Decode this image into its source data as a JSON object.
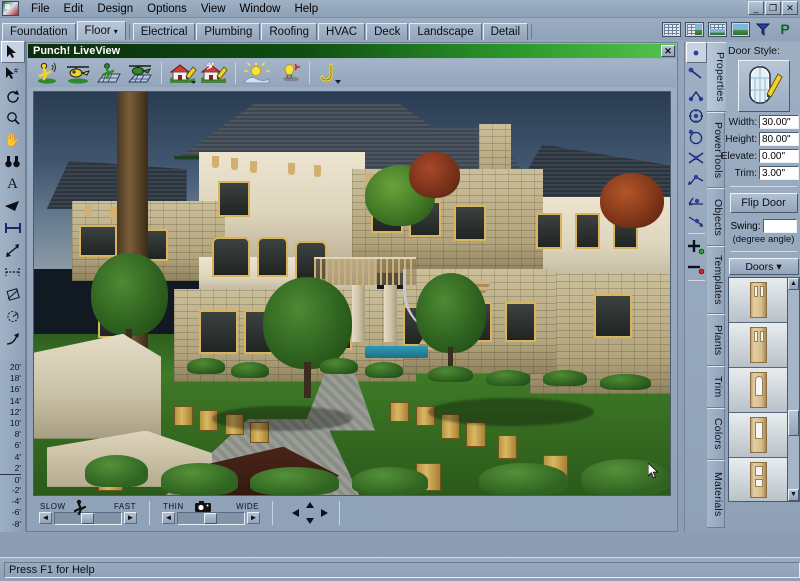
{
  "app": {
    "logo_icon": "punch-app-icon",
    "menu": [
      "File",
      "Edit",
      "Design",
      "Options",
      "View",
      "Window",
      "Help"
    ],
    "window_controls": [
      {
        "name": "minimize-button",
        "glyph": "_"
      },
      {
        "name": "restore-button",
        "glyph": "❐"
      },
      {
        "name": "close-button",
        "glyph": "✕"
      }
    ]
  },
  "tabs": {
    "items": [
      {
        "label": "Foundation",
        "active": false,
        "caret": false
      },
      {
        "label": "Floor",
        "active": true,
        "caret": true
      },
      {
        "label": "Electrical",
        "active": false,
        "caret": false
      },
      {
        "label": "Plumbing",
        "active": false,
        "caret": false
      },
      {
        "label": "Roofing",
        "active": false,
        "caret": false
      },
      {
        "label": "HVAC",
        "active": false,
        "caret": false
      },
      {
        "label": "Deck",
        "active": false,
        "caret": false
      },
      {
        "label": "Landscape",
        "active": false,
        "caret": false
      },
      {
        "label": "Detail",
        "active": false,
        "caret": false
      }
    ],
    "caret_glyph": "▾"
  },
  "view_icons": [
    {
      "name": "view-plan-icon",
      "kind": "grid"
    },
    {
      "name": "view-split-vertical-icon",
      "kind": "split"
    },
    {
      "name": "view-split-horizontal-icon",
      "kind": "splitv"
    },
    {
      "name": "view-render-icon",
      "kind": "pic"
    },
    {
      "name": "filter-funnel-icon",
      "kind": "funnel"
    },
    {
      "name": "punch-logo-icon",
      "kind": "plogo",
      "glyph": "P"
    }
  ],
  "left_toolbar": [
    {
      "name": "tool-select-arrow",
      "selected": true
    },
    {
      "name": "tool-select-group",
      "selected": false
    },
    {
      "name": "tool-rotate",
      "selected": false
    },
    {
      "name": "tool-zoom",
      "selected": false
    },
    {
      "name": "tool-pan-hand",
      "selected": false
    },
    {
      "name": "tool-binoculars",
      "selected": false
    },
    {
      "name": "tool-text",
      "selected": false
    },
    {
      "name": "tool-camera-view",
      "selected": false
    },
    {
      "name": "tool-dimension-linear",
      "selected": false
    },
    {
      "name": "tool-dimension-arrow",
      "selected": false
    },
    {
      "name": "tool-dimension-bracket",
      "selected": false
    },
    {
      "name": "tool-dimension-angled",
      "selected": false
    },
    {
      "name": "tool-dimension-radial",
      "selected": false
    },
    {
      "name": "tool-leader-line",
      "selected": false
    }
  ],
  "ruler": {
    "labels": [
      "20'",
      "18'",
      "16'",
      "14'",
      "12'",
      "10'",
      "8'",
      "6'",
      "4'",
      "2'",
      "0'",
      "-2'",
      "-4'",
      "-6'",
      "-8'"
    ],
    "zero_label": "0'"
  },
  "liveview": {
    "title": "Punch! LiveView",
    "close_glyph": "✕",
    "toolbar": [
      {
        "name": "walkthrough-person-icon"
      },
      {
        "name": "flyover-helicopter-icon"
      },
      {
        "name": "walkthrough-grid-person-icon"
      },
      {
        "name": "flyover-grid-helicopter-icon"
      },
      {
        "name": "edit-exterior-house-icon"
      },
      {
        "name": "edit-interior-house-icon"
      },
      {
        "name": "sunlight-icon"
      },
      {
        "name": "lighting-bulb-icon"
      },
      {
        "name": "draw-path-icon"
      }
    ],
    "speed_slider": {
      "name": "speed-slider",
      "left_label": "SLOW",
      "right_label": "FAST",
      "icon": "running-person-icon"
    },
    "lens_slider": {
      "name": "lens-slider",
      "left_label": "THIN",
      "right_label": "WIDE",
      "icon": "camera-icon"
    },
    "nav_pad": {
      "name": "navigation-pad",
      "up": "▲",
      "down": "▼",
      "left": "◄",
      "right": "►"
    }
  },
  "right_panel": {
    "tools": [
      {
        "name": "tool-point",
        "selected": true
      },
      {
        "name": "tool-line-endpoint",
        "selected": false
      },
      {
        "name": "tool-polyline",
        "selected": false
      },
      {
        "name": "tool-circle-center",
        "selected": false
      },
      {
        "name": "tool-circle-edge",
        "selected": false
      },
      {
        "name": "tool-intersection",
        "selected": false
      },
      {
        "name": "tool-angle-measure",
        "selected": false
      },
      {
        "name": "tool-angle-label",
        "selected": false
      },
      {
        "name": "tool-offset-point",
        "selected": false
      },
      {
        "name": "tool-add-point",
        "selected": false
      },
      {
        "name": "tool-remove-point",
        "selected": false
      }
    ],
    "vtabs": [
      {
        "label": "Properties",
        "active": true,
        "caret": true
      },
      {
        "label": "PowerTools",
        "active": false,
        "caret": false
      },
      {
        "label": "Objects",
        "active": false,
        "caret": false
      },
      {
        "label": "Templates",
        "active": false,
        "caret": false
      },
      {
        "label": "Plants",
        "active": false,
        "caret": false
      },
      {
        "label": "Trim",
        "active": false,
        "caret": false
      },
      {
        "label": "Colors",
        "active": false,
        "caret": false
      },
      {
        "label": "Materials",
        "active": false,
        "caret": false
      }
    ],
    "properties": {
      "style_label": "Door Style:",
      "style_icon": "door-with-pencil-icon",
      "fields": [
        {
          "name": "width-field",
          "label": "Width:",
          "value": "30.00\""
        },
        {
          "name": "height-field",
          "label": "Height:",
          "value": "80.00\""
        },
        {
          "name": "elevate-field",
          "label": "Elevate:",
          "value": "0.00\""
        },
        {
          "name": "trim-field",
          "label": "Trim:",
          "value": "3.00\""
        }
      ],
      "flip_button": "Flip Door",
      "swing_label": "Swing:",
      "swing_value": "",
      "swing_note": "(degree angle)"
    },
    "catalog": {
      "name": "doors-category-dropdown",
      "label": "Doors",
      "caret": "▾",
      "thumbnails": [
        {
          "name": "door-thumb-1",
          "style": "two-panel-glass"
        },
        {
          "name": "door-thumb-2",
          "style": "two-panel-glass"
        },
        {
          "name": "door-thumb-3",
          "style": "arched-glass"
        },
        {
          "name": "door-thumb-4",
          "style": "single-panel-glass"
        },
        {
          "name": "door-thumb-5",
          "style": "six-panel"
        }
      ],
      "scroll_up": "▲",
      "scroll_down": "▼"
    }
  },
  "statusbar": {
    "text": "Press F1 for Help"
  },
  "colors": {
    "accent_green": "#2f9e2e",
    "panel_blue": "#9eafc3",
    "title_dark": "#0c2c0c",
    "field_white": "#ffffff"
  }
}
